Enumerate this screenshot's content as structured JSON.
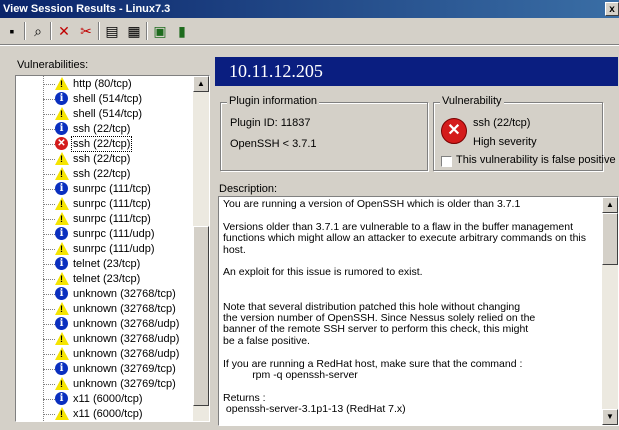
{
  "window": {
    "title": "View Session Results - Linux7.3",
    "close_glyph": "x"
  },
  "toolbar": {
    "icons": [
      "save-icon",
      "find-icon",
      "delete-icon",
      "cut-icon",
      "report-icon",
      "tree-icon",
      "export-icon",
      "exit-icon"
    ],
    "glyphs": [
      "▪",
      "⌕",
      "✕",
      "✂",
      "▤",
      "▦",
      "▣",
      "▮"
    ]
  },
  "vulnerabilities": {
    "label": "Vulnerabilities:",
    "items": [
      {
        "severity": "warn",
        "label": "http (80/tcp)"
      },
      {
        "severity": "info",
        "label": "shell (514/tcp)"
      },
      {
        "severity": "warn",
        "label": "shell (514/tcp)"
      },
      {
        "severity": "info",
        "label": "ssh (22/tcp)"
      },
      {
        "severity": "err",
        "label": "ssh (22/tcp)",
        "selected": true
      },
      {
        "severity": "warn",
        "label": "ssh (22/tcp)"
      },
      {
        "severity": "warn",
        "label": "ssh (22/tcp)"
      },
      {
        "severity": "info",
        "label": "sunrpc (111/tcp)"
      },
      {
        "severity": "warn",
        "label": "sunrpc (111/tcp)"
      },
      {
        "severity": "warn",
        "label": "sunrpc (111/tcp)"
      },
      {
        "severity": "info",
        "label": "sunrpc (111/udp)"
      },
      {
        "severity": "warn",
        "label": "sunrpc (111/udp)"
      },
      {
        "severity": "info",
        "label": "telnet (23/tcp)"
      },
      {
        "severity": "warn",
        "label": "telnet (23/tcp)"
      },
      {
        "severity": "info",
        "label": "unknown (32768/tcp)"
      },
      {
        "severity": "warn",
        "label": "unknown (32768/tcp)"
      },
      {
        "severity": "info",
        "label": "unknown (32768/udp)"
      },
      {
        "severity": "warn",
        "label": "unknown (32768/udp)"
      },
      {
        "severity": "warn",
        "label": "unknown (32768/udp)"
      },
      {
        "severity": "info",
        "label": "unknown (32769/tcp)"
      },
      {
        "severity": "warn",
        "label": "unknown (32769/tcp)"
      },
      {
        "severity": "info",
        "label": "x11 (6000/tcp)"
      },
      {
        "severity": "warn",
        "label": "x11 (6000/tcp)"
      }
    ]
  },
  "host": "10.11.12.205",
  "plugin_info": {
    "legend": "Plugin information",
    "plugin_id": "Plugin ID: 11837",
    "name": "OpenSSH < 3.7.1"
  },
  "vulnerability": {
    "legend": "Vulnerability",
    "port": "ssh (22/tcp)",
    "severity": "High severity",
    "false_positive_label": "This vulnerability is false positive"
  },
  "description": {
    "label": "Description:",
    "text": "You are running a version of OpenSSH which is older than 3.7.1\n\nVersions older than 3.7.1 are vulnerable to a flaw in the buffer management\nfunctions which might allow an attacker to execute arbitrary commands on this\nhost.\n\nAn exploit for this issue is rumored to exist.\n\n\nNote that several distribution patched this hole without changing\nthe version number of OpenSSH. Since Nessus solely relied on the\nbanner of the remote SSH server to perform this check, this might\nbe a false positive.\n\nIf you are running a RedHat host, make sure that the command :\n          rpm -q openssh-server\n\nReturns :\n openssh-server-3.1p1-13 (RedHat 7.x)"
  },
  "colors": {
    "title_start": "#0a246a",
    "title_end": "#3a6ea5",
    "host_bar": "#0a1e80",
    "face": "#d4d0c8"
  }
}
